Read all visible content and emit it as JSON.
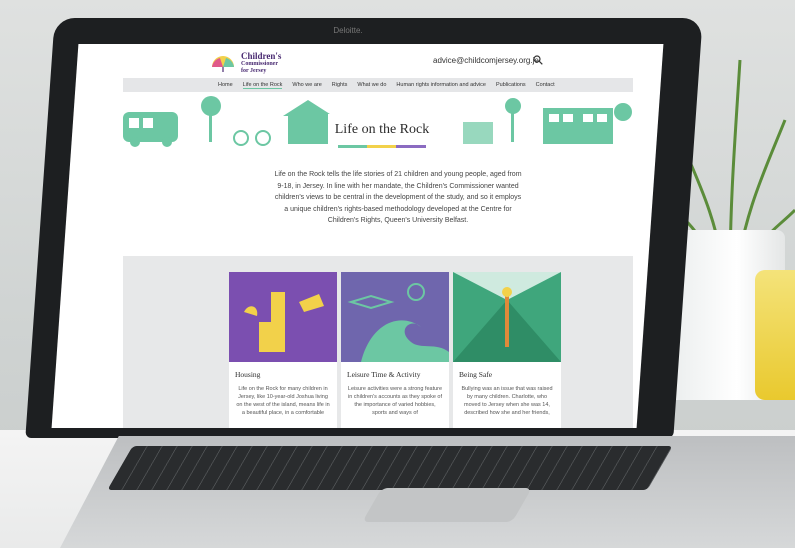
{
  "laptop": {
    "brand_label": "Deloitte."
  },
  "site": {
    "logo": {
      "line1": "Children's",
      "line2": "Commissioner",
      "line3": "for Jersey"
    },
    "email": "advice@childcomjersey.org.je",
    "nav": [
      {
        "label": "Home",
        "active": false
      },
      {
        "label": "Life on the Rock",
        "active": true
      },
      {
        "label": "Who we are",
        "active": false
      },
      {
        "label": "Rights",
        "active": false
      },
      {
        "label": "What we do",
        "active": false
      },
      {
        "label": "Human rights information and advice",
        "active": false
      },
      {
        "label": "Publications",
        "active": false
      },
      {
        "label": "Contact",
        "active": false
      }
    ],
    "hero_title": "Life on the Rock",
    "intro": "Life on the Rock tells the life stories of 21 children and young people, aged from 9-18, in Jersey. In line with her mandate, the Children's Commissioner wanted children's views to be central in the development of the study, and so it employs a unique children's rights-based methodology developed at the Centre for Children's Rights, Queen's University Belfast.",
    "cards": [
      {
        "title": "Housing",
        "text": "Life on the Rock for many children in Jersey, like 10-year-old Joshua living on the west of the island, means life in a beautiful place, in a comfortable",
        "color": "#7b4fb0"
      },
      {
        "title": "Leisure Time & Activity",
        "text": "Leisure activities were a strong feature in children's accounts as they spoke of the importance of varied hobbies, sports and ways of",
        "color": "#6f66ad"
      },
      {
        "title": "Being Safe",
        "text": "Bullying was an issue that was raised by many children. Charlotte, who moved to Jersey when she was 14, described how she and her friends,",
        "color": "#3fa67c"
      }
    ]
  },
  "colors": {
    "accent_green": "#6cc7a3",
    "accent_purple": "#7b4fb0",
    "accent_yellow": "#f2d14a"
  }
}
